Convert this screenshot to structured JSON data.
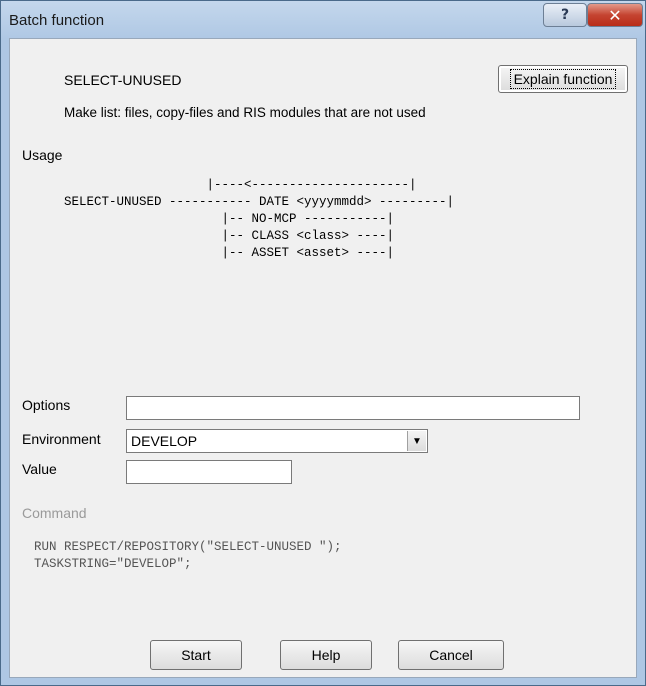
{
  "window": {
    "title": "Batch function",
    "help_glyph": "?",
    "close_glyph": "✕"
  },
  "function": {
    "name": "SELECT-UNUSED",
    "description": "Make list: files, copy-files and RIS modules that are not used",
    "explain_label": "Explain function"
  },
  "usage": {
    "label": "Usage",
    "diagram_lines": [
      "                   |----<---------------------|",
      "SELECT-UNUSED ----------- DATE <yyyymmdd> ---------|",
      "                     |-- NO-MCP -----------|",
      "                     |-- CLASS <class> ----|",
      "                     |-- ASSET <asset> ----|"
    ]
  },
  "form": {
    "options_label": "Options",
    "options_value": "",
    "environment_label": "Environment",
    "environment_value": "DEVELOP",
    "value_label": "Value",
    "value_value": ""
  },
  "command": {
    "label": "Command",
    "lines": [
      "RUN RESPECT/REPOSITORY(\"SELECT-UNUSED \");",
      "TASKSTRING=\"DEVELOP\";"
    ]
  },
  "buttons": {
    "start": "Start",
    "help": "Help",
    "cancel": "Cancel"
  }
}
